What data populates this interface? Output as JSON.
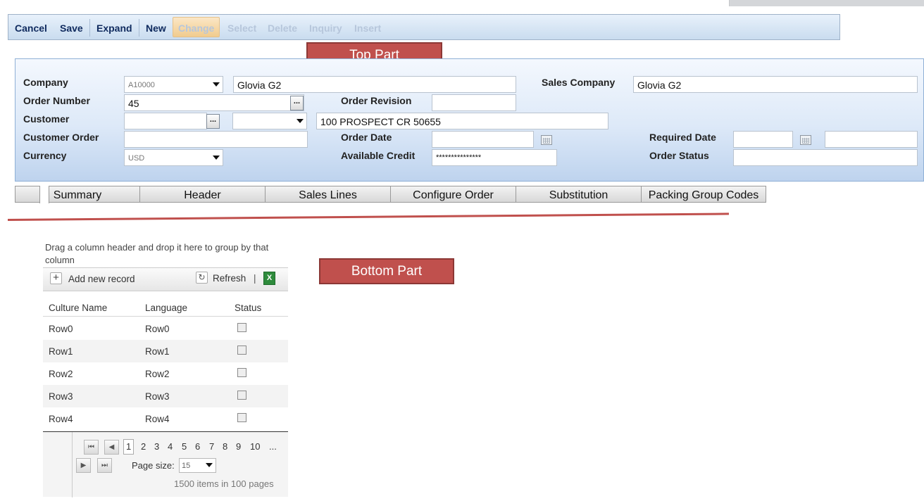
{
  "toolbar": {
    "cancel": "Cancel",
    "save": "Save",
    "expand": "Expand",
    "new": "New",
    "change": "Change",
    "select": "Select",
    "delete": "Delete",
    "inquiry": "Inquiry",
    "insert": "Insert"
  },
  "callouts": {
    "top": "Top Part",
    "bottom": "Bottom Part"
  },
  "form": {
    "company_label": "Company",
    "company_value": "A10000",
    "company_name": "Glovia G2",
    "sales_company_label": "Sales Company",
    "sales_company_value": "Glovia G2",
    "order_number_label": "Order Number",
    "order_number_value": "45",
    "order_revision_label": "Order Revision",
    "order_revision_value": "",
    "customer_label": "Customer",
    "customer_value": "",
    "customer_select": "",
    "customer_address": "100 PROSPECT CR 50655",
    "customer_order_label": "Customer Order",
    "customer_order_value": "",
    "order_date_label": "Order Date",
    "order_date_value": "",
    "required_date_label": "Required Date",
    "required_date_value": "",
    "required_time_value": "",
    "currency_label": "Currency",
    "currency_value": "USD",
    "available_credit_label": "Available Credit",
    "available_credit_value": "***************",
    "order_status_label": "Order Status",
    "order_status_value": ""
  },
  "tabs": [
    "Summary",
    "Header",
    "Sales Lines",
    "Configure Order",
    "Substitution",
    "Packing Group Codes"
  ],
  "grid": {
    "group_hint": "Drag a column header and drop it here to group by that column",
    "add_new": "Add new record",
    "refresh": "Refresh",
    "separator": "|",
    "columns": [
      "Culture Name",
      "Language",
      "Status"
    ],
    "rows": [
      {
        "culture": "Row0",
        "language": "Row0",
        "status": false
      },
      {
        "culture": "Row1",
        "language": "Row1",
        "status": false
      },
      {
        "culture": "Row2",
        "language": "Row2",
        "status": false
      },
      {
        "culture": "Row3",
        "language": "Row3",
        "status": false
      },
      {
        "culture": "Row4",
        "language": "Row4",
        "status": false
      }
    ],
    "pager": {
      "pages": [
        "1",
        "2",
        "3",
        "4",
        "5",
        "6",
        "7",
        "8",
        "9",
        "10",
        "..."
      ],
      "current_page": "1",
      "page_size_label": "Page size:",
      "page_size": "15",
      "summary": "1500 items in 100 pages"
    }
  },
  "colors": {
    "accent_red": "#c0504d",
    "toolbar_text": "#0f2a5e"
  },
  "icons": [
    "dropdown-caret-icon",
    "ellipsis-icon",
    "calendar-icon",
    "plus-icon",
    "refresh-icon",
    "excel-export-icon",
    "first-page-icon",
    "prev-page-icon",
    "next-page-icon",
    "last-page-icon"
  ]
}
